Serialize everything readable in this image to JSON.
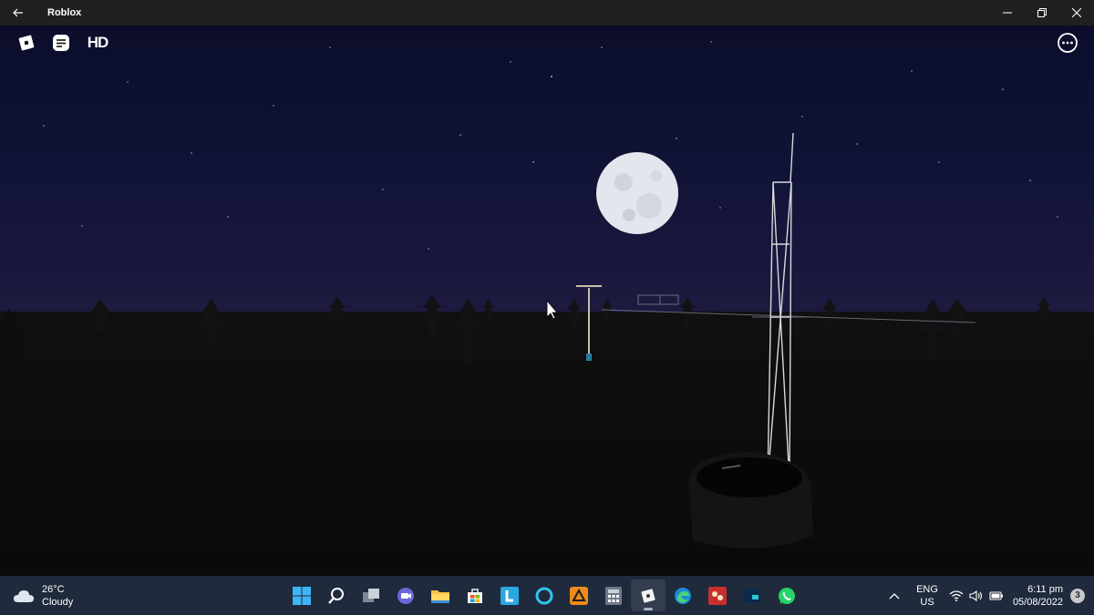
{
  "window": {
    "title": "Roblox"
  },
  "hud": {
    "menu_icon": "roblox-logo-icon",
    "chat_icon": "chat-icon",
    "quality_label": "HD",
    "more_icon": "more-options-icon"
  },
  "taskbar": {
    "weather": {
      "temperature": "26°C",
      "condition": "Cloudy"
    },
    "apps": [
      "start",
      "search",
      "task-view",
      "teams-chat",
      "file-explorer",
      "microsoft-store",
      "l-app",
      "alexa",
      "game-app",
      "calculator",
      "roblox",
      "edge",
      "game-launcher",
      "app",
      "whatsapp"
    ],
    "language": {
      "lang": "ENG",
      "region": "US"
    },
    "clock": {
      "time": "6:11 pm",
      "date": "05/08/2022"
    },
    "notifications_count": "3"
  }
}
